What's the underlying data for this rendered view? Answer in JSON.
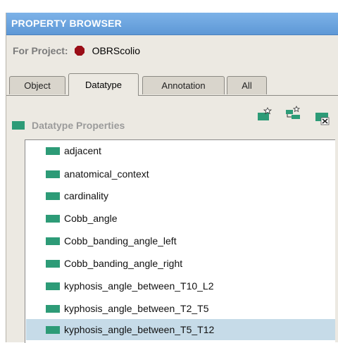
{
  "panel": {
    "title": "PROPERTY BROWSER"
  },
  "project": {
    "label": "For Project:",
    "name": "OBRScolio",
    "icon": "project-hexagon-icon",
    "icon_color": "#9a0e17"
  },
  "tabs": [
    {
      "label": "Object",
      "active": false
    },
    {
      "label": "Datatype",
      "active": true
    },
    {
      "label": "Annotation",
      "active": false
    },
    {
      "label": "All",
      "active": false
    }
  ],
  "section": {
    "title": "Datatype Properties",
    "icon_color": "#2d9b77",
    "actions": [
      {
        "name": "create-datatype-property-icon"
      },
      {
        "name": "create-subproperty-icon"
      },
      {
        "name": "delete-datatype-property-icon"
      }
    ]
  },
  "properties": [
    {
      "label": "adjacent",
      "selected": false
    },
    {
      "label": "anatomical_context",
      "selected": false
    },
    {
      "label": "cardinality",
      "selected": false
    },
    {
      "label": "Cobb_angle",
      "selected": false
    },
    {
      "label": "Cobb_banding_angle_left",
      "selected": false
    },
    {
      "label": "Cobb_banding_angle_right",
      "selected": false
    },
    {
      "label": "kyphosis_angle_between_T10_L2",
      "selected": false
    },
    {
      "label": "kyphosis_angle_between_T2_T5",
      "selected": false
    },
    {
      "label": "kyphosis_angle_between_T5_T12",
      "selected": true
    }
  ]
}
